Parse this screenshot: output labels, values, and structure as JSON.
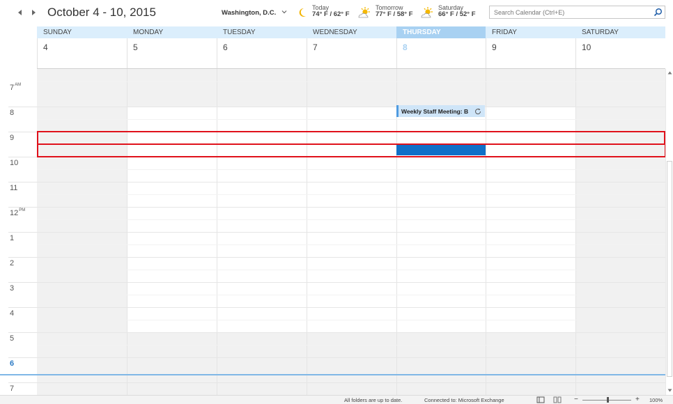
{
  "header": {
    "date_range": "October 4 - 10, 2015",
    "location": "Washington, D.C.",
    "weather": [
      {
        "label": "Today",
        "temp": "74° F / 62° F",
        "icon": "crescent-moon-icon"
      },
      {
        "label": "Tomorrow",
        "temp": "77° F / 58° F",
        "icon": "sun-behind-cloud-icon"
      },
      {
        "label": "Saturday",
        "temp": "66° F / 52° F",
        "icon": "sun-behind-cloud-icon"
      }
    ],
    "search_placeholder": "Search Calendar (Ctrl+E)"
  },
  "days": [
    {
      "name": "SUNDAY",
      "date": "4"
    },
    {
      "name": "MONDAY",
      "date": "5"
    },
    {
      "name": "TUESDAY",
      "date": "6"
    },
    {
      "name": "WEDNESDAY",
      "date": "7"
    },
    {
      "name": "THURSDAY",
      "date": "8"
    },
    {
      "name": "FRIDAY",
      "date": "9"
    },
    {
      "name": "SATURDAY",
      "date": "10"
    }
  ],
  "hours": [
    {
      "label": "7",
      "suffix": "AM"
    },
    {
      "label": "8",
      "suffix": ""
    },
    {
      "label": "9",
      "suffix": ""
    },
    {
      "label": "10",
      "suffix": ""
    },
    {
      "label": "11",
      "suffix": ""
    },
    {
      "label": "12",
      "suffix": "PM"
    },
    {
      "label": "1",
      "suffix": ""
    },
    {
      "label": "2",
      "suffix": ""
    },
    {
      "label": "3",
      "suffix": ""
    },
    {
      "label": "4",
      "suffix": ""
    },
    {
      "label": "5",
      "suffix": ""
    },
    {
      "label": "6",
      "suffix": ""
    },
    {
      "label": "7",
      "suffix": ""
    }
  ],
  "event": {
    "title": "Weekly Staff Meeting: B",
    "icon": "recurring-icon"
  },
  "status": {
    "sync": "All folders are up to date.",
    "connection": "Connected to: Microsoft Exchange",
    "zoom": "100%",
    "zoom_fraction": 0.5
  },
  "colors": {
    "accent": "#1070c8",
    "today_header": "#a8d1f2",
    "highlight": "#e0111b"
  }
}
